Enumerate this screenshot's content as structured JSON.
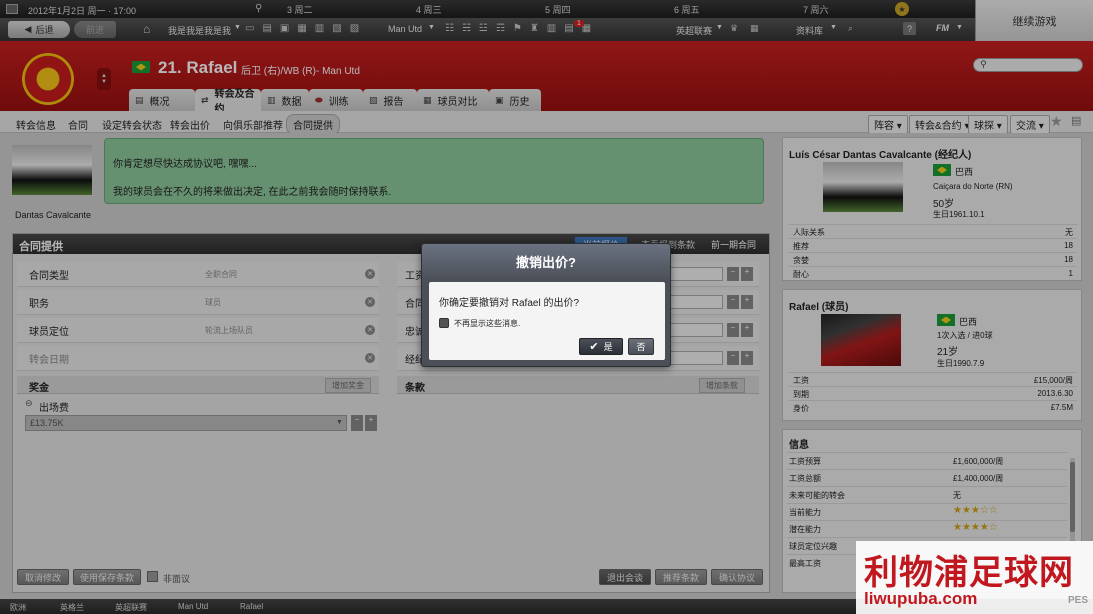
{
  "topbar": {
    "date": "2012年1月2日 周一 · 17:00",
    "days": [
      "3 周二",
      "4 周三",
      "5 周四",
      "6 周五",
      "7 周六"
    ]
  },
  "nav": {
    "back": "后退",
    "forward": "前进",
    "my_home": "我是我是我是我",
    "team": "Man Utd",
    "league": "英超联赛",
    "database": "资料库",
    "fm": "FM",
    "continue_label": "继续游戏",
    "badge": "1"
  },
  "player": {
    "number_name": "21. Rafael",
    "position_club": "后卫 (右)/WB (R)- Man Utd"
  },
  "tabs": [
    "概况",
    "转会及合约",
    "数据",
    "训练",
    "报告",
    "球员对比",
    "历史"
  ],
  "subnav": {
    "items": [
      "转会信息",
      "合同",
      "设定转会状态",
      "转会出价",
      "向俱乐部推荐",
      "合同提供"
    ],
    "right": [
      "阵容",
      "转会&合约",
      "球探",
      "交流"
    ]
  },
  "message": {
    "line1": "你肯定想尽快达成协议吧, 嘿嘿...",
    "line2": "我的球员会在不久的将来做出决定, 在此之前我会随时保持联系.",
    "sender": "Dantas Cavalcante"
  },
  "contract": {
    "title": "合同提供",
    "tabs": [
      "当前报价",
      "查看报到条款",
      "前一期合同"
    ],
    "rows": [
      {
        "label": "合同类型",
        "value": "全职合同"
      },
      {
        "label": "职务",
        "value": "球员"
      },
      {
        "label": "球员定位",
        "value": "轮流上场队员"
      },
      {
        "label": "转会日期",
        "value": ""
      }
    ],
    "right_rows": [
      "工资",
      "合同",
      "忠诚",
      "经纪"
    ],
    "bonus_title": "奖金",
    "add_bonus": "增加奖金",
    "terms_title": "条款",
    "add_terms": "增加条款",
    "appearance_fee": "出场费",
    "appearance_value": "£13.75K",
    "cancel_changes": "取消修改",
    "use_saved": "使用保存条款",
    "non_negotiable": "非面议",
    "quit_talks": "退出会谈",
    "propose": "推荐条款",
    "confirm": "确认协议"
  },
  "agent": {
    "title": "Luís César Dantas Cavalcante (经纪人)",
    "nation": "巴西",
    "birthplace": "Caiçara do Norte (RN)",
    "age": "50岁",
    "dob": "生日1961.10.1",
    "stats": [
      {
        "k": "人际关系",
        "v": "无"
      },
      {
        "k": "推荐",
        "v": "18"
      },
      {
        "k": "贪婪",
        "v": "18"
      },
      {
        "k": "耐心",
        "v": "1"
      }
    ]
  },
  "player_card": {
    "title": "Rafael (球员)",
    "nation": "巴西",
    "caps": "1次入选 / 进0球",
    "age": "21岁",
    "dob": "生日1990.7.9",
    "stats": [
      {
        "k": "工资",
        "v": "£15,000/周"
      },
      {
        "k": "到期",
        "v": "2013.6.30"
      },
      {
        "k": "身价",
        "v": "£7.5M"
      }
    ]
  },
  "info": {
    "title": "信息",
    "rows": [
      {
        "k": "工资预算",
        "v": "£1,600,000/周"
      },
      {
        "k": "工资总额",
        "v": "£1,400,000/周"
      },
      {
        "k": "未来可能的转会",
        "v": "无"
      },
      {
        "k": "当前能力",
        "v": "★★★☆☆"
      },
      {
        "k": "潜在能力",
        "v": "★★★★☆"
      },
      {
        "k": "球员定位兴趣",
        "v": ""
      },
      {
        "k": "最高工资",
        "v": ""
      }
    ],
    "current_stars": 3,
    "potential_stars": 4
  },
  "dialog": {
    "title": "撤销出价?",
    "question": "你确定要撤销对 Rafael 的出价?",
    "checkbox": "不再显示这些消息.",
    "yes": "是",
    "no": "否"
  },
  "statusbar": [
    "欧洲",
    "英格兰",
    "英超联赛",
    "Man Utd",
    "Rafael"
  ],
  "watermark": {
    "title": "利物浦足球网",
    "url": "liwupuba.com",
    "pes": "PES"
  },
  "colors": {
    "red": "#b81818",
    "green_msg": "#8ec99b",
    "dark_panel": "#3a3a3a",
    "dialog_title": "#555d6a"
  }
}
